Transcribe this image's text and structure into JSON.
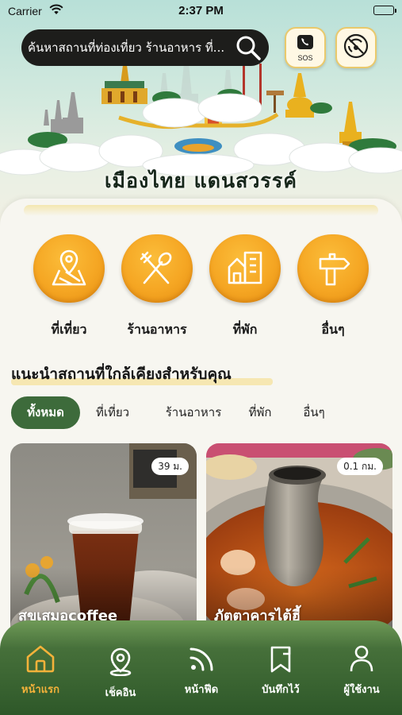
{
  "status_bar": {
    "carrier": "Carrier",
    "time": "2:37 PM"
  },
  "search": {
    "placeholder": "ค้นหาสถานที่ท่องเที่ยว ร้านอาหาร ที่..."
  },
  "top_buttons": {
    "sos_label": "SOS"
  },
  "hero": {
    "title": "เมืองไทย แดนสวรรค์"
  },
  "categories": [
    {
      "label": "ที่เที่ยว",
      "icon": "map-pin-icon"
    },
    {
      "label": "ร้านอาหาร",
      "icon": "utensils-icon"
    },
    {
      "label": "ที่พัก",
      "icon": "building-icon"
    },
    {
      "label": "อื่นๆ",
      "icon": "signpost-icon"
    }
  ],
  "recommend": {
    "title": "แนะนำสถานที่ใกล้เคียงสำหรับคุณ",
    "filters": [
      {
        "label": "ทั้งหมด",
        "active": true
      },
      {
        "label": "ที่เที่ยว",
        "active": false
      },
      {
        "label": "ร้านอาหาร",
        "active": false
      },
      {
        "label": "ที่พัก",
        "active": false
      },
      {
        "label": "อื่นๆ",
        "active": false
      }
    ],
    "places": [
      {
        "name": "สุขเสมอcoffee",
        "distance": "39 ม."
      },
      {
        "name": "ภัตตาคารไต้ฮี้",
        "distance": "0.1 กม."
      }
    ]
  },
  "bottom_nav": [
    {
      "label": "หน้าแรก",
      "icon": "home-icon",
      "active": true
    },
    {
      "label": "เช็คอิน",
      "icon": "location-pin-icon",
      "active": false
    },
    {
      "label": "หน้าฟีด",
      "icon": "feed-icon",
      "active": false
    },
    {
      "label": "บันทึกไว้",
      "icon": "bookmark-icon",
      "active": false
    },
    {
      "label": "ผู้ใช้งาน",
      "icon": "user-icon",
      "active": false
    }
  ],
  "colors": {
    "accent_orange": "#f5a623",
    "active_green": "#3d6b3b",
    "nav_green": "#2e5829",
    "nav_active": "#f4b23a"
  }
}
